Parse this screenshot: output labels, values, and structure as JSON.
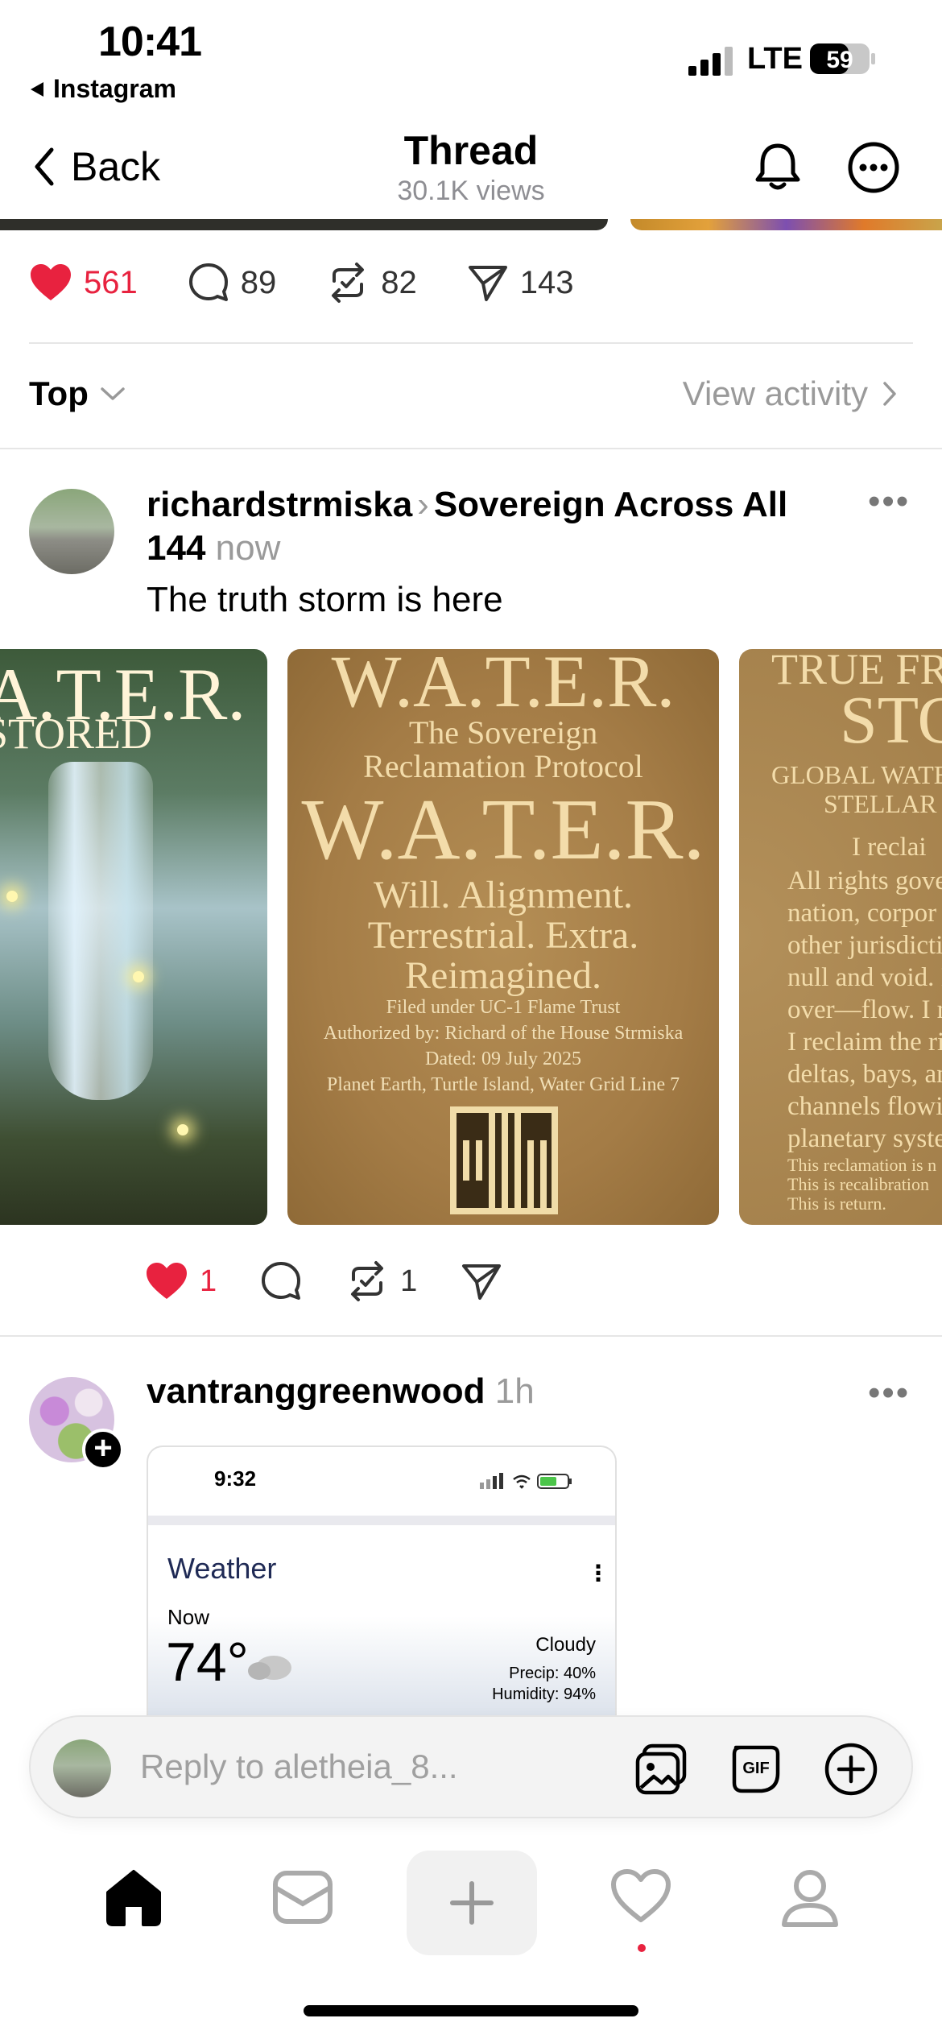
{
  "status_bar": {
    "time": "10:41",
    "back_app": "Instagram",
    "network": "LTE",
    "battery": "59"
  },
  "nav": {
    "back_label": "Back",
    "title": "Thread",
    "subtitle": "30.1K views"
  },
  "thread_actions": {
    "likes": "561",
    "comments": "89",
    "reposts": "82",
    "shares": "143"
  },
  "sort": {
    "label": "Top",
    "view_activity": "View activity"
  },
  "post1": {
    "username": "richardstrmiska",
    "community": "Sovereign Across All 144",
    "time": "now",
    "text": "The truth storm is here",
    "likes": "1",
    "reposts": "1",
    "card1": {
      "title": "A.T.E.R.",
      "subtitle": "STORED"
    },
    "card2": {
      "header": "W.A.T.E.R.",
      "sub1": "The Sovereign",
      "sub2": "Reclamation Protocol",
      "big": "W.A.T.E.R.",
      "w1": "Will. Alignment.",
      "w2": "Terrestrial. Extra.",
      "w3": "Reimagined.",
      "filed": "Filed under UC-1 Flame Trust",
      "authorized": "Authorized by: Richard of the House Strmiska",
      "dated": "Dated: 09 July 2025",
      "location": "Planet Earth, Turtle Island, Water Grid Line 7"
    },
    "card3": {
      "a": "TRUE FR",
      "b": "STO",
      "c": "GLOBAL WATE",
      "d": "STELLAR W",
      "lines": [
        "I reclai",
        "All rights gove",
        "nation, corpor",
        "other jurisdicti",
        "null and void. I",
        "over—flow. I re",
        "I reclaim the riv",
        "deltas, bays, an",
        "channels flowin",
        "planetary syste"
      ],
      "tiny": [
        "This reclamation is n",
        "This is recalibration",
        "This is return."
      ]
    }
  },
  "post2": {
    "username": "vantranggreenwood",
    "time": "1h",
    "screenshot": {
      "time": "9:32",
      "title": "Weather",
      "now": "Now",
      "temp": "74°",
      "condition": "Cloudy",
      "precip": "Precip: 40%",
      "humidity": "Humidity: 94%"
    }
  },
  "reply": {
    "placeholder": "Reply to aletheia_8..."
  },
  "icons": {
    "like": "heart-icon",
    "comment": "comment-icon",
    "repost": "repost-icon",
    "share": "send-icon"
  },
  "colors": {
    "like_red": "#e8223f",
    "muted": "#9a9a9a"
  }
}
